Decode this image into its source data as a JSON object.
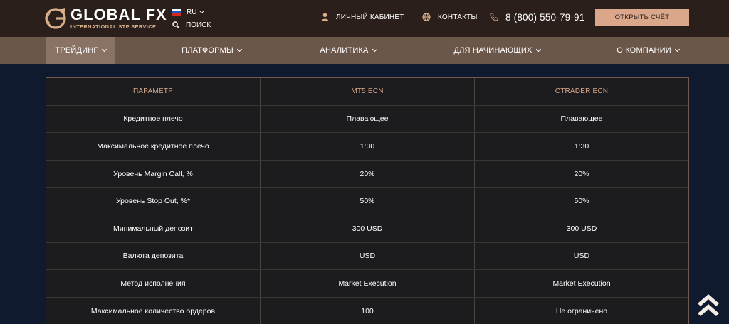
{
  "header": {
    "logo": {
      "name": "GLOBAL FX",
      "tagline": "INTERNATIONAL STP SERVICE"
    },
    "language": {
      "label": "RU"
    },
    "search": {
      "label": "ПОИСК"
    },
    "account_link": "ЛИЧНЫЙ КАБИНЕТ",
    "contacts_link": "КОНТАКТЫ",
    "phone": "8 (800) 550-79-91",
    "cta_button": "ОТКРЫТЬ СЧЁТ"
  },
  "nav": {
    "items": [
      {
        "label": "ТРЕЙДИНГ",
        "active": true
      },
      {
        "label": "ПЛАТФОРМЫ"
      },
      {
        "label": "АНАЛИТИКА"
      },
      {
        "label": "ДЛЯ НАЧИНАЮЩИХ"
      },
      {
        "label": "О КОМПАНИИ"
      }
    ]
  },
  "table": {
    "columns": [
      "ПАРАМЕТР",
      "MT5 ECN",
      "CTRADER ECN"
    ],
    "rows": [
      [
        "Кредитное плечо",
        "Плавающее",
        "Плавающее"
      ],
      [
        "Максимальное кредитное плечо",
        "1:30",
        "1:30"
      ],
      [
        "Уровень Margin Call, %",
        "20%",
        "20%"
      ],
      [
        "Уровень Stop Out, %*",
        "50%",
        "50%"
      ],
      [
        "Минимальный депозит",
        "300 USD",
        "300 USD"
      ],
      [
        "Валюта депозита",
        "USD",
        "USD"
      ],
      [
        "Метод исполнения",
        "Market Execution",
        "Market Execution"
      ],
      [
        "Максимальное количество ордеров",
        "100",
        "Не ограничено"
      ]
    ]
  },
  "colors": {
    "header_bg": "#2a1f1b",
    "nav_bg": "#6b564a",
    "nav_active_bg": "#8a7264",
    "accent": "#dba78a",
    "page_bg": "#0f1a2e",
    "table_bg": "#1c1b1e"
  },
  "icons": {
    "logo": "globe-g-logo-icon",
    "flag": "russia-flag-icon",
    "search": "search-icon",
    "account": "user-icon",
    "contacts": "globe-icon",
    "phone": "phone-icon",
    "scroll_top": "double-chevron-up-icon"
  }
}
